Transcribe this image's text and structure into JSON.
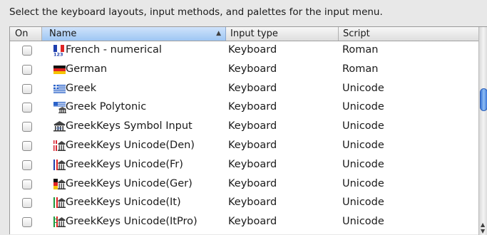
{
  "instruction": "Select the keyboard layouts, input methods, and palettes for the input menu.",
  "columns": {
    "on": "On",
    "name": "Name",
    "input_type": "Input type",
    "script": "Script"
  },
  "sort_indicator": "▲",
  "rows": [
    {
      "name": "French - numerical",
      "input_type": "Keyboard",
      "script": "Roman",
      "checked": false,
      "icon": "france-numeric-flag-icon"
    },
    {
      "name": "German",
      "input_type": "Keyboard",
      "script": "Roman",
      "checked": false,
      "icon": "germany-flag-icon"
    },
    {
      "name": "Greek",
      "input_type": "Keyboard",
      "script": "Unicode",
      "checked": false,
      "icon": "greece-flag-icon"
    },
    {
      "name": "Greek Polytonic",
      "input_type": "Keyboard",
      "script": "Unicode",
      "checked": false,
      "icon": "greece-temple-flag-icon"
    },
    {
      "name": "GreekKeys Symbol Input",
      "input_type": "Keyboard",
      "script": "Unicode",
      "checked": false,
      "icon": "temple-icon"
    },
    {
      "name": "GreekKeys Unicode(Den)",
      "input_type": "Keyboard",
      "script": "Unicode",
      "checked": false,
      "icon": "denmark-temple-icon"
    },
    {
      "name": "GreekKeys Unicode(Fr)",
      "input_type": "Keyboard",
      "script": "Unicode",
      "checked": false,
      "icon": "france-temple-icon"
    },
    {
      "name": "GreekKeys Unicode(Ger)",
      "input_type": "Keyboard",
      "script": "Unicode",
      "checked": false,
      "icon": "germany-temple-icon"
    },
    {
      "name": "GreekKeys Unicode(It)",
      "input_type": "Keyboard",
      "script": "Unicode",
      "checked": false,
      "icon": "italy-temple-icon"
    },
    {
      "name": "GreekKeys Unicode(ItPro)",
      "input_type": "Keyboard",
      "script": "Unicode",
      "checked": false,
      "icon": "italy-pro-temple-icon"
    }
  ],
  "scrollbar": {
    "up_arrow": "▲",
    "down_arrow": "▼"
  },
  "colors": {
    "selected_header": "#9ec6f3",
    "scroll_thumb": "#3b76d8",
    "window_bg": "#e8e8e8"
  }
}
